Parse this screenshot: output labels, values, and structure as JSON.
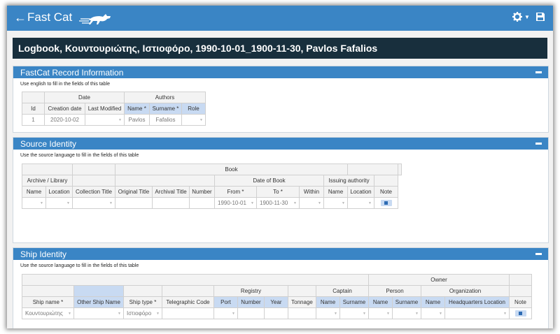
{
  "app": {
    "name": "Fast Cat"
  },
  "title": "Logbook, Κουντουριώτης, Ιστιοφόρο, 1990-10-01_1900-11-30, Pavlos Fafalios",
  "icons": {
    "back": "arrow-left-icon",
    "gear": "gear-icon",
    "save": "save-icon",
    "collapse": "minus-icon",
    "note": "document-icon",
    "logo": "running-cat-icon"
  },
  "colors": {
    "topbar": "#3a85c5",
    "title_bar": "#182f3d",
    "panel_header": "#3a85c5",
    "selected_header": "#c8daf2"
  },
  "record": {
    "header": "FastCat Record Information",
    "hint": "Use english to fill in the fields of this table",
    "groups": {
      "date": "Date",
      "authors": "Authors"
    },
    "cols": {
      "id": "Id",
      "creation": "Creation date",
      "modified": "Last Modified",
      "name": "Name *",
      "surname": "Surname *",
      "role": "Role"
    },
    "row": {
      "id": "1",
      "creation": "2020-10-02",
      "modified": "",
      "name": "Pavlos",
      "surname": "Fafalios",
      "role": ""
    }
  },
  "source": {
    "header": "Source Identity",
    "hint": "Use the source language to fill in the fields of this table",
    "groups": {
      "book": "Book",
      "archive": "Archive / Library",
      "date_of_book": "Date of Book",
      "issuing": "Issuing authority"
    },
    "cols": {
      "name": "Name",
      "location": "Location",
      "collection_title": "Collection Title",
      "original_title": "Original Title",
      "archival_title": "Archival Title",
      "number": "Number",
      "from": "From *",
      "to": "To *",
      "within": "Within",
      "issuing_name": "Name",
      "issuing_location": "Location",
      "note": "Note"
    },
    "row": {
      "from": "1990-10-01",
      "to": "1900-11-30"
    }
  },
  "ship": {
    "header": "Ship Identity",
    "hint": "Use the source language to fill in the fields of this table",
    "groups": {
      "owner": "Owner",
      "registry": "Registry",
      "captain": "Captain",
      "person": "Person",
      "organization": "Organization"
    },
    "cols": {
      "ship_name": "Ship name *",
      "other_name": "Other Ship Name",
      "ship_type": "Ship type *",
      "telegraphic": "Telegraphic Code",
      "port": "Port",
      "number": "Number",
      "year": "Year",
      "tonnage": "Tonnage",
      "captain_name": "Name",
      "captain_surname": "Surname",
      "person_name": "Name",
      "person_surname": "Surname",
      "org_name": "Name",
      "hq_location": "Headquarters Location",
      "note": "Note"
    },
    "row": {
      "ship_name": "Κουντουριώτης",
      "ship_type": "Ιστιοφόρο"
    }
  }
}
